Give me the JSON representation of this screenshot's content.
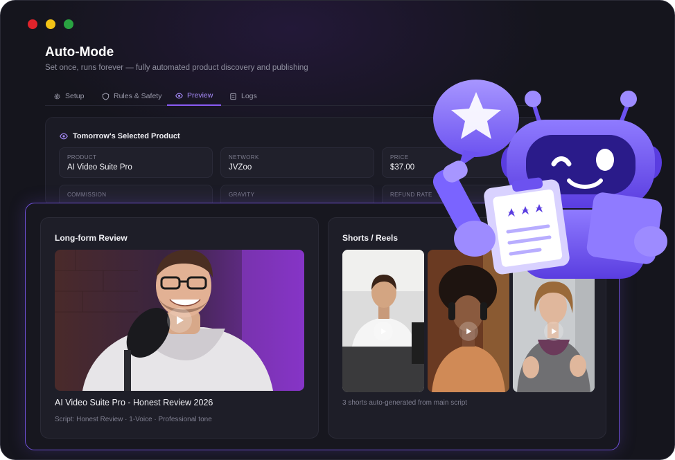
{
  "window": {
    "controls": [
      "close",
      "minimize",
      "maximize"
    ]
  },
  "page": {
    "title": "Auto-Mode",
    "subtitle": "Set once, runs forever — fully automated product discovery and publishing"
  },
  "tabs": [
    {
      "label": "Setup",
      "icon": "gear-icon",
      "active": false
    },
    {
      "label": "Rules & Safety",
      "icon": "shield-icon",
      "active": false
    },
    {
      "label": "Preview",
      "icon": "eye-icon",
      "active": true
    },
    {
      "label": "Logs",
      "icon": "scroll-icon",
      "active": false
    }
  ],
  "selected_product": {
    "heading": "Tomorrow's Selected Product",
    "icon": "eye-icon",
    "fields": [
      {
        "label": "PRODUCT",
        "value": "AI Video Suite Pro"
      },
      {
        "label": "NETWORK",
        "value": "JVZoo"
      },
      {
        "label": "PRICE",
        "value": "$37.00"
      },
      {
        "label": "COMMISSION",
        "value": ""
      },
      {
        "label": "GRAVITY",
        "value": ""
      },
      {
        "label": "REFUND RATE",
        "value": ""
      }
    ]
  },
  "long_form": {
    "title": "Long-form Review",
    "video_title": "AI Video Suite Pro - Honest Review 2026",
    "meta": "Script: Honest Review · 1-Voice · Professional tone"
  },
  "shorts": {
    "title": "Shorts / Reels",
    "caption": "3 shorts auto-generated from main script",
    "count": 3
  },
  "colors": {
    "accent": "#8b5cf6",
    "accent_light": "#a78bfa",
    "background": "#15151d",
    "card": "#1e1e28"
  }
}
